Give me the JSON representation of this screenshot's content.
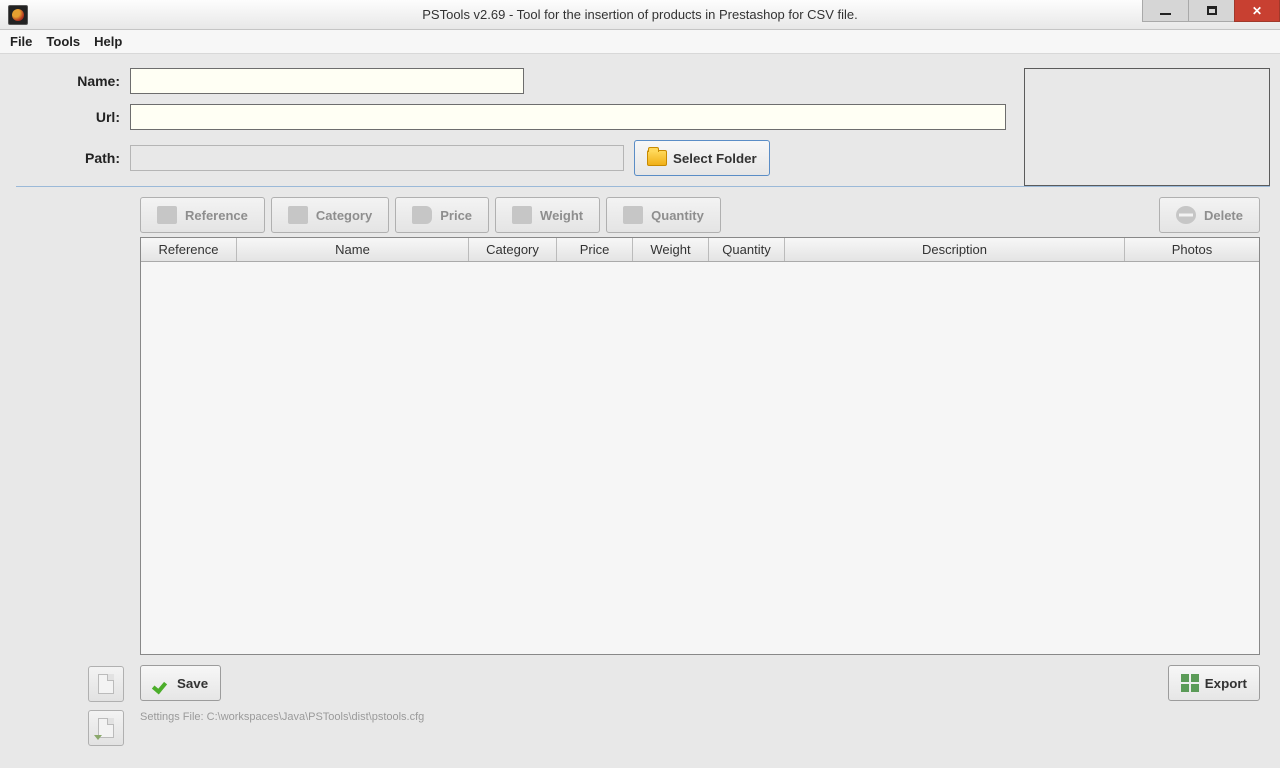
{
  "window": {
    "title": "PSTools v2.69 - Tool for the insertion of products in Prestashop for CSV file."
  },
  "menu": {
    "file": "File",
    "tools": "Tools",
    "help": "Help"
  },
  "form": {
    "name_label": "Name:",
    "name_value": "",
    "url_label": "Url:",
    "url_value": "",
    "path_label": "Path:",
    "path_value": "",
    "select_folder": "Select Folder"
  },
  "toolbar": {
    "reference": "Reference",
    "category": "Category",
    "price": "Price",
    "weight": "Weight",
    "quantity": "Quantity",
    "delete": "Delete"
  },
  "table": {
    "headers": {
      "reference": "Reference",
      "name": "Name",
      "category": "Category",
      "price": "Price",
      "weight": "Weight",
      "quantity": "Quantity",
      "description": "Description",
      "photos": "Photos"
    }
  },
  "actions": {
    "save": "Save",
    "export": "Export"
  },
  "status": {
    "text": "Settings File: C:\\workspaces\\Java\\PSTools\\dist\\pstools.cfg"
  }
}
